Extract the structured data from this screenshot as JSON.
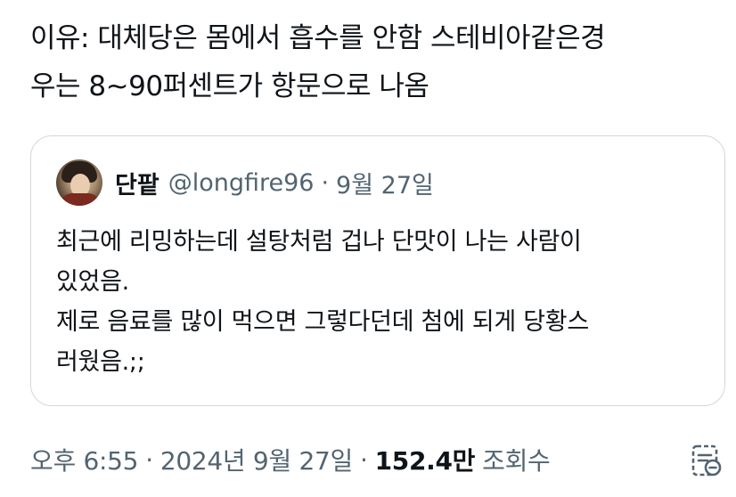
{
  "tweet": {
    "text_lines": [
      "이유: 대체당은 몸에서 흡수를 안함 스테비아같은경",
      "우는 8~90퍼센트가 항문으로 나옴"
    ]
  },
  "quoted_tweet": {
    "display_name": "단팥",
    "handle": "@longfire96",
    "separator": "·",
    "date": "9월 27일",
    "avatar_icon": "user-avatar-photo",
    "body_lines": [
      "최근에 리밍하는데 설탕처럼 겁나 단맛이 나는 사람이",
      "있었음.",
      "제로 음료를 많이 먹으면 그렇다던데 첨에 되게 당황스",
      "러웠음.;;"
    ]
  },
  "meta": {
    "time": "오후 6:55",
    "dot": "·",
    "date": "2024년 9월 27일",
    "views_count": "152.4만",
    "views_label": "조회수",
    "analytics_icon": "analytics-icon"
  },
  "colors": {
    "text_primary": "#0f1419",
    "text_secondary": "#536471",
    "border": "#cfd9de"
  }
}
